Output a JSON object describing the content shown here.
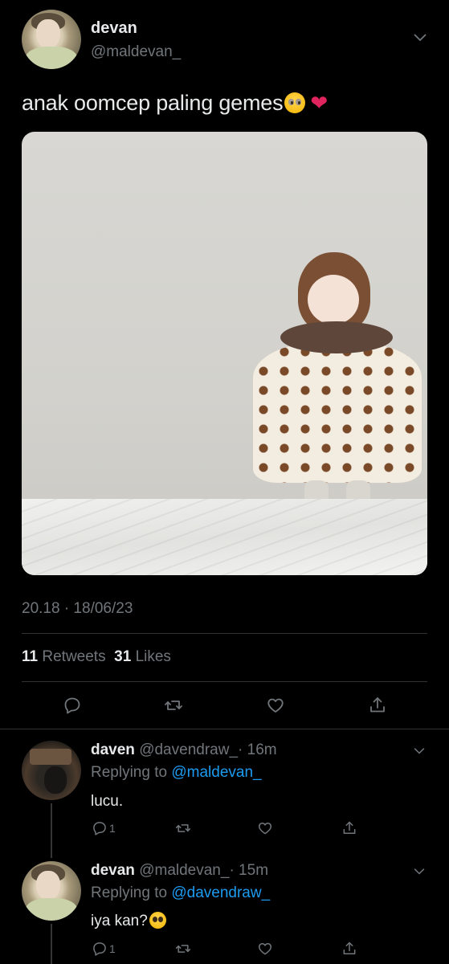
{
  "main_tweet": {
    "author_name": "devan",
    "author_handle": "@maldevan_",
    "text": "anak oomcep paling gemes",
    "emoji_1": "pleading-face-emoji",
    "emoji_2": "red-heart-emoji",
    "timestamp": "20.18 · 18/06/23",
    "retweets_count": "11",
    "retweets_label": "Retweets",
    "likes_count": "31",
    "likes_label": "Likes"
  },
  "replies": [
    {
      "author_name": "daven",
      "author_handle": "@davendraw_",
      "time": "· 16m",
      "replying_prefix": "Replying to",
      "replying_to": "@maldevan_",
      "text": "lucu.",
      "reply_count": "1"
    },
    {
      "author_name": "devan",
      "author_handle": "@maldevan_",
      "time": "· 15m",
      "replying_prefix": "Replying to",
      "replying_to": "@davendraw_",
      "text": "iya kan?",
      "reply_count": "1"
    }
  ],
  "colors": {
    "background": "#000000",
    "text": "#e7e9ea",
    "muted": "#71767b",
    "link": "#1d9bf0",
    "heart": "#e0245e"
  }
}
